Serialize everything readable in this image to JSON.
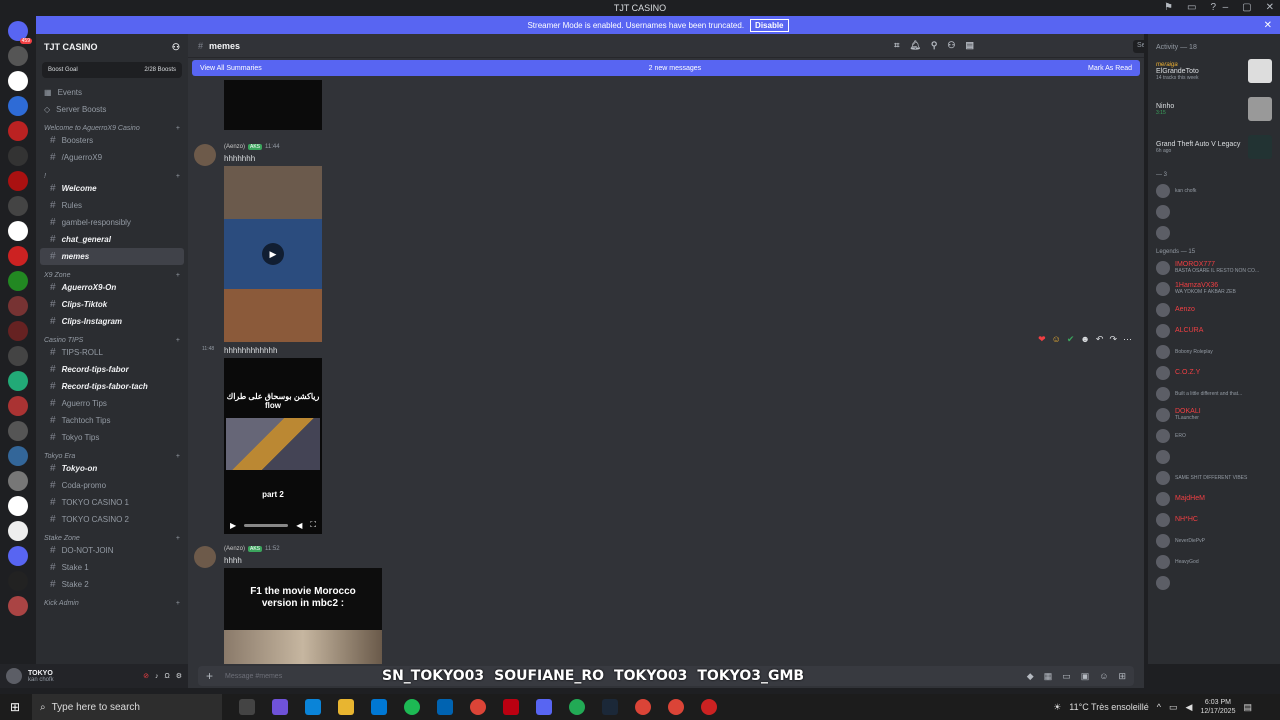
{
  "window": {
    "title": "TJT CASINO"
  },
  "streamer_banner": {
    "text": "Streamer Mode is enabled. Usernames have been truncated.",
    "button": "Disable"
  },
  "guild": {
    "name": "TJT CASINO",
    "boost_goal": "Boost Goal",
    "boost_count": "2/28 Boosts",
    "nav": [
      {
        "label": "Events",
        "icon": "calendar-icon"
      },
      {
        "label": "Server Boosts",
        "icon": "boost-icon"
      }
    ],
    "sections": [
      {
        "category": "Welcome to AguerroX9 Casino",
        "channels": [
          {
            "label": "Boosters",
            "bold": false
          },
          {
            "label": "/AguerroX9",
            "bold": false
          }
        ]
      },
      {
        "category": "!",
        "channels": [
          {
            "label": "Welcome",
            "bold": true
          },
          {
            "label": "Rules",
            "bold": false
          },
          {
            "label": "gambel-responsibly",
            "bold": false
          },
          {
            "label": "chat_general",
            "bold": true
          },
          {
            "label": "memes",
            "bold": true,
            "selected": true
          }
        ]
      },
      {
        "category": "X9 Zone",
        "channels": [
          {
            "label": "AguerroX9-On",
            "bold": true
          },
          {
            "label": "Clips-Tiktok",
            "bold": true
          },
          {
            "label": "Clips-Instagram",
            "bold": true
          }
        ]
      },
      {
        "category": "Casino TIPS",
        "channels": [
          {
            "label": "TIPS-ROLL",
            "bold": false
          },
          {
            "label": "Record-tips-fabor",
            "bold": true
          },
          {
            "label": "Record-tips-fabor-tach",
            "bold": true
          },
          {
            "label": "Aguerro Tips",
            "bold": false
          },
          {
            "label": "Tachtoch Tips",
            "bold": false
          },
          {
            "label": "Tokyo Tips",
            "bold": false
          }
        ]
      },
      {
        "category": "Tokyo Era",
        "channels": [
          {
            "label": "Tokyo-on",
            "bold": true
          },
          {
            "label": "Coda-promo",
            "bold": false
          },
          {
            "label": "TOKYO CASINO 1",
            "bold": false
          },
          {
            "label": "TOKYO CASINO 2",
            "bold": false
          }
        ]
      },
      {
        "category": "Stake Zone",
        "channels": [
          {
            "label": "DO-NOT-JOIN",
            "bold": false
          },
          {
            "label": "Stake 1",
            "bold": false
          },
          {
            "label": "Stake 2",
            "bold": false
          }
        ]
      },
      {
        "category": "Kick Admin",
        "channels": []
      }
    ]
  },
  "user": {
    "name": "TOKYO",
    "status": "kan chofk"
  },
  "chat": {
    "channel": "memes",
    "search_placeholder": "Search TJT CASINO",
    "new_messages": {
      "left": "View All Summaries",
      "center": "2 new messages",
      "right": "Mark As Read"
    },
    "messages": [
      {
        "author": "(Aenzo)",
        "tag": "AKS",
        "time": "11:44",
        "text": "hhhhhhh"
      },
      {
        "author": "",
        "tag": "",
        "time": "11:48",
        "text": "hhhhhhhhhhhh",
        "video_caption": "رياكشن بوسحاق على طراك flow",
        "video_part": "part 2"
      },
      {
        "author": "(Aenzo)",
        "tag": "AKS",
        "time": "11:52",
        "text": "hhhh",
        "image_caption": "F1 the movie Morocco version in mbc2 :"
      }
    ],
    "composer_placeholder": "Message #memes"
  },
  "socials": [
    "SN_TOKYO03",
    "SOUFIANE_RO",
    "TOKYO03",
    "TOKYO3_GMB"
  ],
  "members": {
    "activity_header": "Activity — 18",
    "activities": [
      {
        "name": "ElGrandeToto",
        "detail": "14 tracks this week",
        "label": "meraiga"
      },
      {
        "name": "Ninho",
        "detail": "3:15"
      },
      {
        "name": "Grand Theft Auto V Legacy",
        "detail": "6h ago"
      }
    ],
    "group1_header": "— 3",
    "group2_header": "Legends — 15",
    "list": [
      {
        "name": "",
        "sub": "kan chofk"
      },
      {
        "name": "",
        "sub": ""
      },
      {
        "name": "",
        "sub": ""
      },
      {
        "name": "IMOROX777",
        "sub": "BASTA OSARE IL RESTO NON CO..."
      },
      {
        "name": "1HamzaVX36",
        "sub": "WA YDKOM F AKBAR ZEB"
      },
      {
        "name": "Aenzo",
        "sub": ""
      },
      {
        "name": "ALCURA",
        "sub": ""
      },
      {
        "name": "",
        "sub": "Bobony Roleplay"
      },
      {
        "name": "C.O.Z.Y",
        "sub": ""
      },
      {
        "name": "",
        "sub": "Built a little different and that..."
      },
      {
        "name": "DOKALI",
        "sub": "TLauncher"
      },
      {
        "name": "",
        "sub": "ERO"
      },
      {
        "name": "",
        "sub": ""
      },
      {
        "name": "",
        "sub": "SAME SHIT DIFFERENT VIBES"
      },
      {
        "name": "MajdHeM",
        "sub": ""
      },
      {
        "name": "NH*HC",
        "sub": ""
      },
      {
        "name": "",
        "sub": "NeverDiePvP"
      },
      {
        "name": "",
        "sub": "HeavyGod"
      },
      {
        "name": "",
        "sub": ""
      }
    ]
  },
  "taskbar": {
    "search": "Type here to search",
    "weather": "11°C Très ensoleillé",
    "time": "6:03 PM",
    "date": "12/17/2025"
  }
}
